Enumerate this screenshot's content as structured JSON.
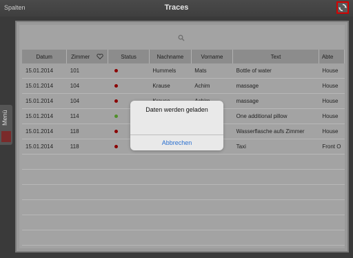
{
  "header": {
    "left_label": "Spalten",
    "title": "Traces",
    "refresh_icon": "refresh-icon",
    "refresh_border_color": "#d40000"
  },
  "side_tab": {
    "label": "Menü"
  },
  "search": {
    "icon": "search-icon"
  },
  "table": {
    "columns": [
      "Datum",
      "Zimmer",
      "Status",
      "Nachname",
      "Vorname",
      "Text",
      "Abte"
    ],
    "rows": [
      {
        "datum": "15.01.2014",
        "zimmer": "101",
        "status_color": "#8b0000",
        "nachname": "Hummels",
        "vorname": "Mats",
        "text": "Bottle of water",
        "abteilung": "House"
      },
      {
        "datum": "15.01.2014",
        "zimmer": "104",
        "status_color": "#8b0000",
        "nachname": "Krause",
        "vorname": "Achim",
        "text": "massage",
        "abteilung": "House"
      },
      {
        "datum": "15.01.2014",
        "zimmer": "104",
        "status_color": "#8b0000",
        "nachname": "Krause",
        "vorname": "Achim",
        "text": "massage",
        "abteilung": "House"
      },
      {
        "datum": "15.01.2014",
        "zimmer": "114",
        "status_color": "#4f8f2a",
        "nachname": "",
        "vorname": "",
        "text": "One additional pillow",
        "abteilung": "House"
      },
      {
        "datum": "15.01.2014",
        "zimmer": "118",
        "status_color": "#8b0000",
        "nachname": "",
        "vorname": "",
        "text": "Wasserflasche aufs Zimmer",
        "abteilung": "House"
      },
      {
        "datum": "15.01.2014",
        "zimmer": "118",
        "status_color": "#8b0000",
        "nachname": "",
        "vorname": "",
        "text": "Taxi",
        "abteilung": "Front O"
      }
    ]
  },
  "dialog": {
    "message": "Daten werden geladen",
    "button": "Abbrechen"
  }
}
